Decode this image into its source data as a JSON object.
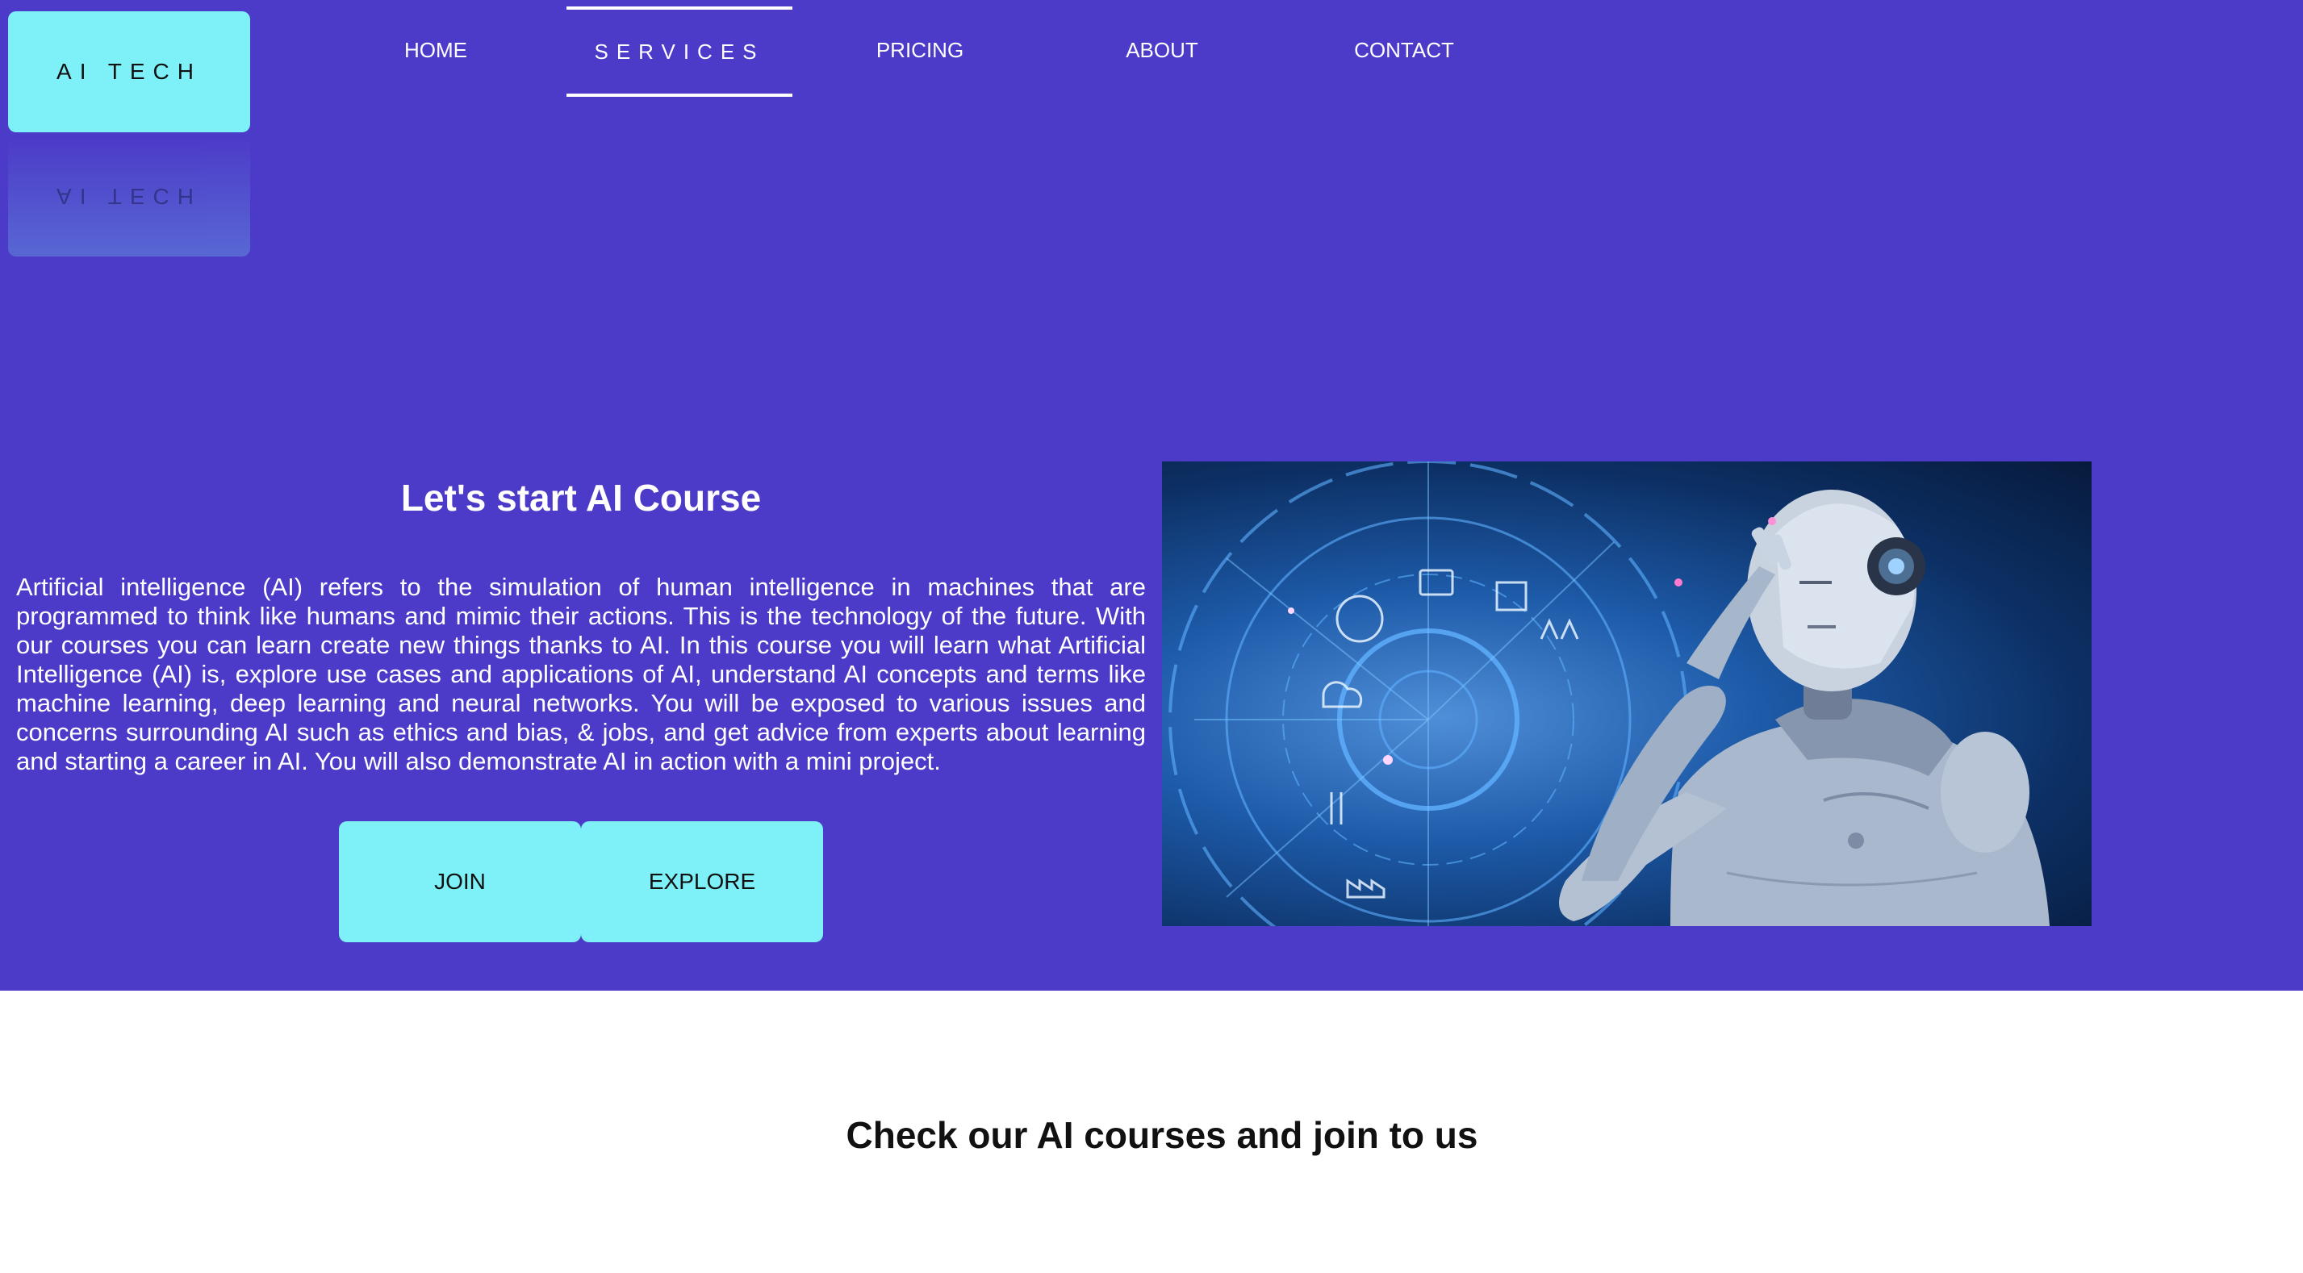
{
  "brand": {
    "logo": "AI TECH"
  },
  "nav": {
    "items": [
      {
        "label": "HOME"
      },
      {
        "label": "SERVICES"
      },
      {
        "label": "PRICING"
      },
      {
        "label": "ABOUT"
      },
      {
        "label": "CONTACT"
      }
    ],
    "active": "SERVICES"
  },
  "hero": {
    "title": "Let's start AI Course",
    "body": "Artificial intelligence (AI) refers to the simulation of human intelligence in machines that are programmed to think like humans and mimic their actions. This is the technology of the future. With our courses you can learn create new things thanks to AI. In this course you will learn what Artificial Intelligence (AI) is, explore use cases and applications of AI, understand AI concepts and terms like machine learning, deep learning and neural networks. You will be exposed to various issues and concerns surrounding AI such as ethics and bias, & jobs, and get advice from experts about learning and starting a career in AI. You will also demonstrate AI in action with a mini project.",
    "buttons": {
      "join": "JOIN",
      "explore": "EXPLORE"
    },
    "image_icon": "robot-illustration"
  },
  "courses": {
    "title": "Check our AI courses and join to us"
  },
  "colors": {
    "hero_bg": "#4c3ac8",
    "accent": "#7ef0f8",
    "page_bg": "#ffffff"
  }
}
